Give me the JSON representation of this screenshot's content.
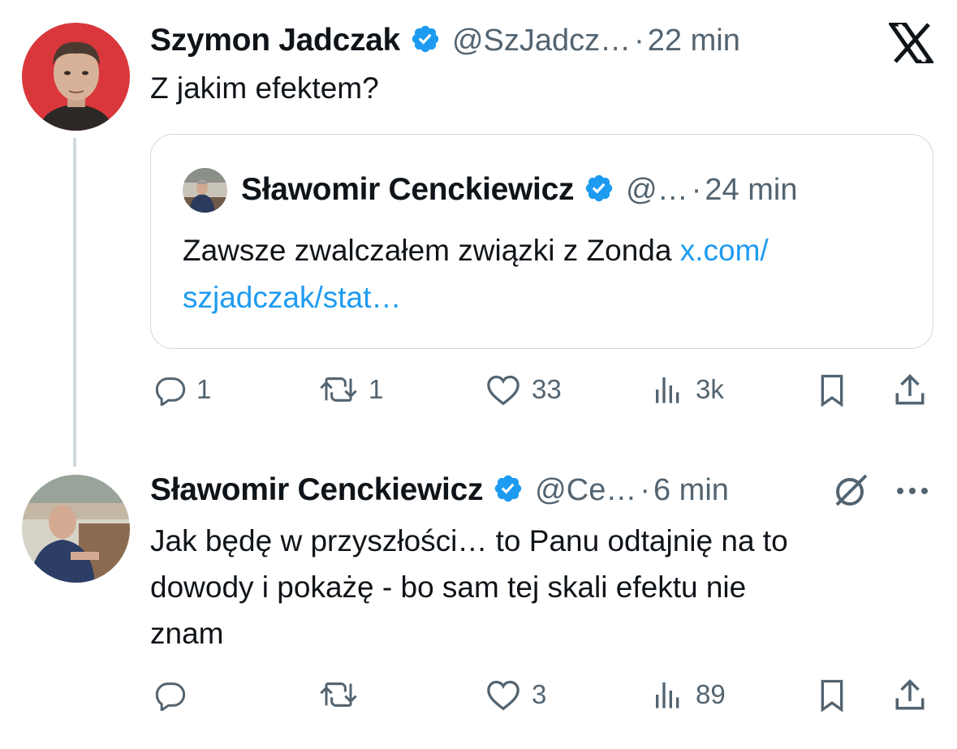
{
  "x_logo": "X",
  "tweet1": {
    "author_name": "Szymon Jadczak",
    "handle": "@SzJadcz…",
    "separator": "·",
    "time": "22 min",
    "text": "Z jakim efektem?",
    "quote": {
      "author_name": "Sławomir Cenckiewicz",
      "handle": "@…",
      "separator": "·",
      "time": "24 min",
      "text": "Zawsze zwalczałem związki z Zonda",
      "link_line1": "x.com/",
      "link_line2": "szjadczak/stat…"
    },
    "actions": {
      "replies": "1",
      "reposts": "1",
      "likes": "33",
      "views": "3k"
    }
  },
  "tweet2": {
    "author_name": "Sławomir Cenckiewicz",
    "handle": "@Ce…",
    "separator": "·",
    "time": "6 min",
    "text_line1": "Jak będę w przyszłości… to Panu odtajnię na to",
    "text_line2": "dowody i pokażę - bo sam tej skali efektu nie",
    "text_line3": "znam",
    "actions": {
      "replies": "",
      "reposts": "",
      "likes": "3",
      "views": "89"
    }
  },
  "colors": {
    "verified": "#1d9bf0",
    "link": "#1d9bf0",
    "secondary": "#536471",
    "avatar1_bg": "#d9373b"
  },
  "icons": [
    "x-logo-icon",
    "verified-badge-icon",
    "reply-icon",
    "repost-icon",
    "like-icon",
    "views-icon",
    "bookmark-icon",
    "share-icon",
    "grok-icon",
    "more-icon"
  ]
}
